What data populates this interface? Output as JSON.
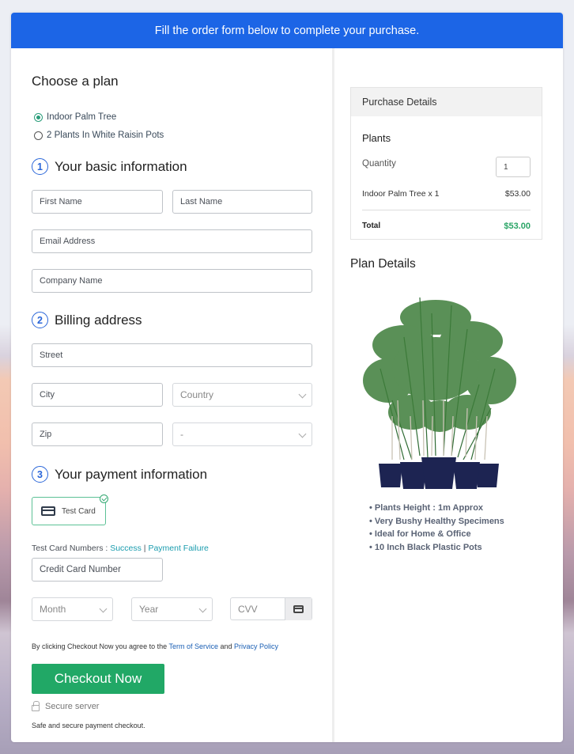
{
  "banner": {
    "text": "Fill the order form below to complete your purchase."
  },
  "plan": {
    "heading": "Choose a plan",
    "options": [
      {
        "label": "Indoor Palm Tree",
        "selected": true
      },
      {
        "label": "2 Plants In White Raisin Pots",
        "selected": false
      }
    ]
  },
  "basic_info": {
    "step": "1",
    "heading": "Your basic information",
    "first_name_placeholder": "First Name",
    "last_name_placeholder": "Last Name",
    "email_placeholder": "Email Address",
    "company_placeholder": "Company Name"
  },
  "billing": {
    "step": "2",
    "heading": "Billing address",
    "street_placeholder": "Street",
    "city_placeholder": "City",
    "country_value": "Country",
    "zip_placeholder": "Zip",
    "state_value": "-"
  },
  "payment": {
    "step": "3",
    "heading": "Your payment information",
    "method_label": "Test Card",
    "test_numbers_label": "Test Card Numbers : ",
    "success_link": "Success",
    "separator": " | ",
    "failure_link": "Payment Failure",
    "card_number_placeholder": "Credit Card Number",
    "month_value": "Month",
    "year_value": "Year",
    "cvv_placeholder": "CVV"
  },
  "agreement": {
    "prefix": "By clicking Checkout Now you agree to the ",
    "tos_link": "Term of Service",
    "and": " and ",
    "privacy_link": "Privacy Policy"
  },
  "checkout": {
    "button_label": "Checkout Now",
    "secure_label": "Secure server",
    "safe_note": "Safe and secure payment checkout."
  },
  "purchase_details": {
    "heading": "Purchase Details",
    "category": "Plants",
    "quantity_label": "Quantity",
    "quantity_value": "1",
    "item_label": "Indoor Palm Tree x 1",
    "item_price": "$53.00",
    "total_label": "Total",
    "total_value": "$53.00"
  },
  "plan_details": {
    "heading": "Plan Details",
    "image_alt": "Indoor palm trees in five dark blue pots",
    "features": [
      "Plants Height : 1m Approx",
      "Very Bushy Healthy Specimens",
      "Ideal for Home & Office",
      "10 Inch Black Plastic Pots"
    ]
  },
  "colors": {
    "banner": "#1c65e6",
    "checkout_button": "#21a866",
    "accent_teal": "#2a9d7a",
    "total_green": "#2aa566",
    "link_teal": "#1a9cae",
    "link_blue": "#1a5fb4"
  }
}
